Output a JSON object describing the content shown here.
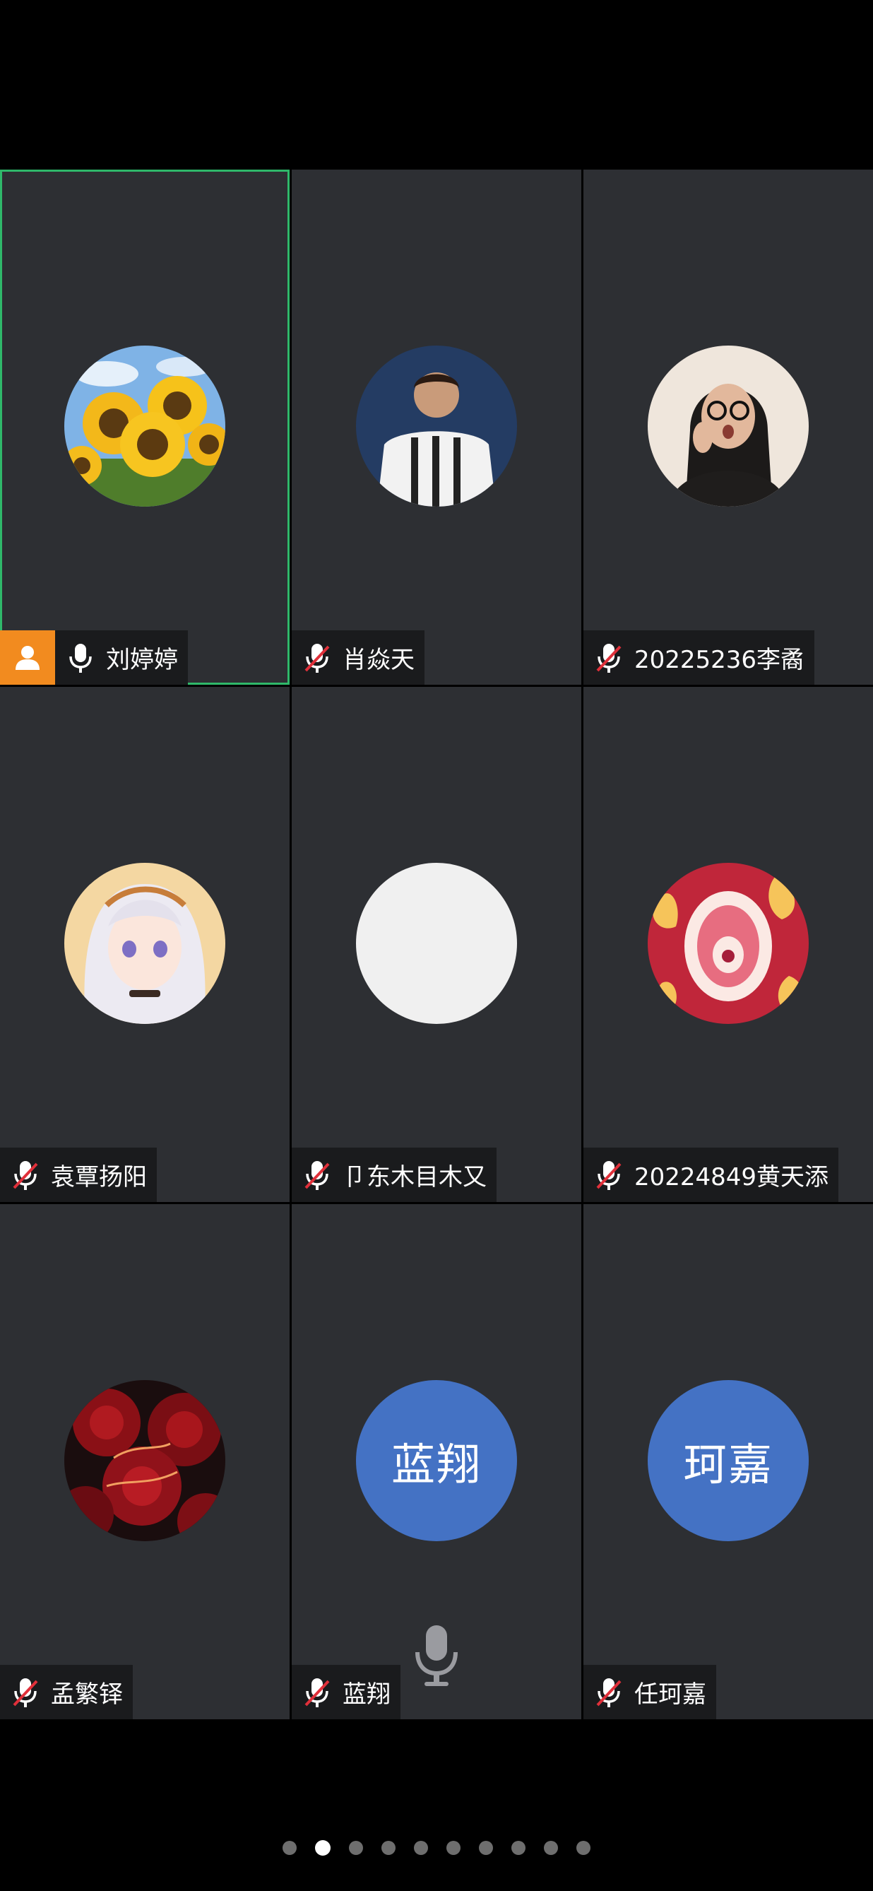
{
  "participants": [
    {
      "name": "刘婷婷",
      "mic": "on",
      "host": true,
      "avatar": "sunflower-photo"
    },
    {
      "name": "肖焱天",
      "mic": "muted",
      "host": false,
      "avatar": "footballer-photo"
    },
    {
      "name": "20225236李矞",
      "mic": "muted",
      "host": false,
      "avatar": "girl-photo"
    },
    {
      "name": "袁覃扬阳",
      "mic": "muted",
      "host": false,
      "avatar": "anime-photo"
    },
    {
      "name": "卩东木目木又",
      "mic": "muted",
      "host": false,
      "avatar": "blank"
    },
    {
      "name": "20224849黄天添",
      "mic": "muted",
      "host": false,
      "avatar": "cartoon-mouth"
    },
    {
      "name": "孟繁铎",
      "mic": "muted",
      "host": false,
      "avatar": "red-roses"
    },
    {
      "name": "蓝翔",
      "mic": "muted",
      "host": false,
      "avatar": "text",
      "avatar_text": "蓝翔"
    },
    {
      "name": "任珂嘉",
      "mic": "muted",
      "host": false,
      "avatar": "text",
      "avatar_text": "珂嘉"
    }
  ],
  "pager": {
    "total": 10,
    "active_index": 1
  },
  "colors": {
    "tile_bg": "#2d2f33",
    "active_border": "#2fb86a",
    "host_badge": "#f28b1f",
    "text_avatar_bg": "#4472c4",
    "muted_slash": "#e0303a"
  },
  "icons": {
    "host": "person-icon",
    "mic_on": "microphone-icon",
    "mic_off": "microphone-muted-icon",
    "floating_mic": "microphone-icon"
  }
}
